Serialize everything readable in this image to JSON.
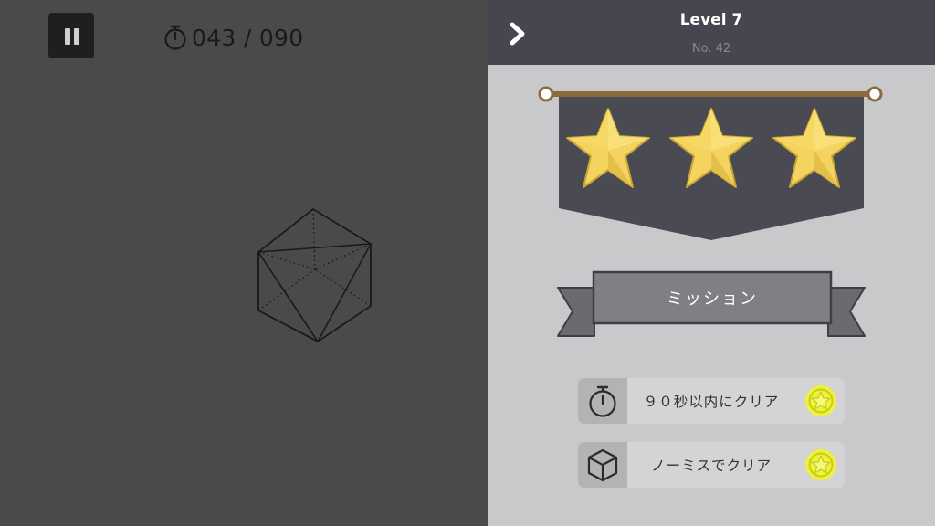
{
  "hud": {
    "timer_text": "043 / 090"
  },
  "panel": {
    "level_title": "Level 7",
    "level_number": "No. 42",
    "stars_earned": 3,
    "stars_total": 3,
    "mission_title": "ミッション",
    "missions": [
      {
        "icon": "stopwatch-icon",
        "label": "９０秒以内にクリア",
        "completed": true
      },
      {
        "icon": "cube-icon",
        "label": "ノーミスでクリア",
        "completed": true
      }
    ]
  },
  "colors": {
    "game_background": "#4a4a4a",
    "panel_background": "#c9c9cb",
    "header_background": "#464650",
    "banner_background": "#4a4a52",
    "star_gold": "#f4d35e",
    "badge_yellow": "#eef23a"
  }
}
